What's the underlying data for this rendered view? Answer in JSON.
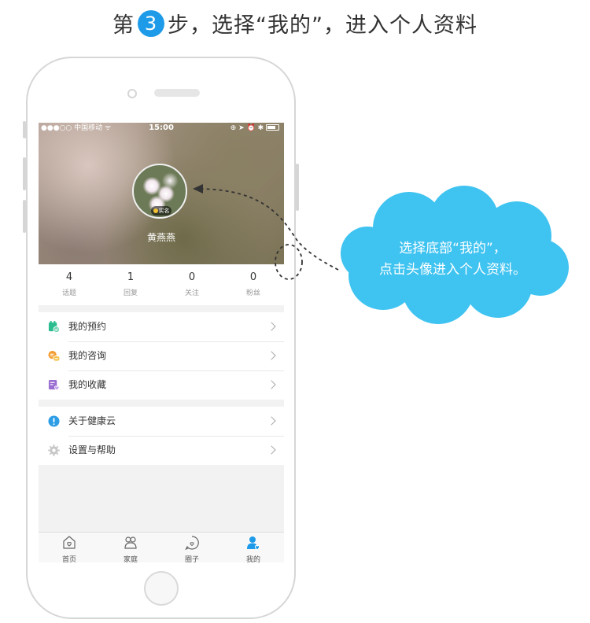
{
  "heading": {
    "prefix": "第",
    "step_number": "3",
    "suffix": "步，选择“我的”，进入个人资料"
  },
  "status_bar": {
    "carrier": "●●●○○ 中国移动 ᯤ",
    "time": "15:00",
    "right_icons": "⊕ ➤ ⏰ ✱"
  },
  "profile": {
    "avatar_badge": "实名",
    "username": "黄燕燕"
  },
  "stats": [
    {
      "value": "4",
      "label": "话题"
    },
    {
      "value": "1",
      "label": "回复"
    },
    {
      "value": "0",
      "label": "关注"
    },
    {
      "value": "0",
      "label": "粉丝"
    }
  ],
  "menu_group_1": [
    {
      "label": "我的预约",
      "icon": "calendar-check-icon",
      "color": "#2bbd8f"
    },
    {
      "label": "我的咨询",
      "icon": "chat-bubbles-icon",
      "color": "#f39c2f"
    },
    {
      "label": "我的收藏",
      "icon": "favorites-list-icon",
      "color": "#9b6fd1"
    }
  ],
  "menu_group_2": [
    {
      "label": "关于健康云",
      "icon": "info-icon",
      "color": "#2d9de6"
    },
    {
      "label": "设置与帮助",
      "icon": "gear-icon",
      "color": "#c8c8c8"
    }
  ],
  "tabs": [
    {
      "label": "首页",
      "icon": "home-heart-icon"
    },
    {
      "label": "家庭",
      "icon": "family-icon"
    },
    {
      "label": "圈子",
      "icon": "chat-circle-icon"
    },
    {
      "label": "我的",
      "icon": "person-heart-icon",
      "active": true
    }
  ],
  "callout": {
    "line1": "选择底部“我的”，",
    "line2": "点击头像进入个人资料。"
  },
  "colors": {
    "accent": "#1e9be8",
    "cloud": "#3fc3f1",
    "active_tab": "#1e9be8"
  }
}
